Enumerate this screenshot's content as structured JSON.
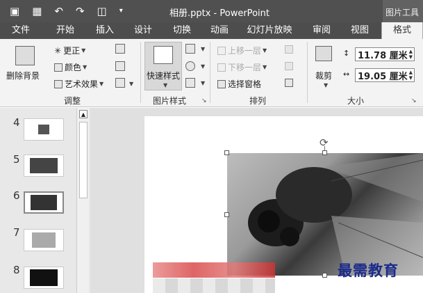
{
  "titlebar": {
    "title": "相册.pptx - PowerPoint",
    "context_tab": "图片工具"
  },
  "tabs": [
    "文件",
    "开始",
    "插入",
    "设计",
    "切换",
    "动画",
    "幻灯片放映",
    "审阅",
    "视图",
    "格式"
  ],
  "ribbon": {
    "remove_bg": "删除背景",
    "adjust": {
      "corrections": "更正",
      "color": "颜色",
      "artistic": "艺术效果",
      "label": "调整"
    },
    "picture_styles": {
      "quick_styles": "快速样式",
      "label": "图片样式"
    },
    "arrange": {
      "bring_forward": "上移一层",
      "send_backward": "下移一层",
      "selection_pane": "选择窗格",
      "label": "排列"
    },
    "size": {
      "crop": "裁剪",
      "height": "11.78 厘米",
      "width": "19.05 厘米",
      "label": "大小"
    }
  },
  "thumbnails": [
    {
      "num": "4",
      "selected": false
    },
    {
      "num": "5",
      "selected": false
    },
    {
      "num": "6",
      "selected": true
    },
    {
      "num": "7",
      "selected": false
    },
    {
      "num": "8",
      "selected": false
    }
  ],
  "watermark": "最需教育",
  "icons": {
    "save": "save-icon",
    "undo": "undo-icon",
    "redo": "redo-icon",
    "start_show": "start-show-icon",
    "customize": "customize-qat-icon",
    "app": "powerpoint-icon"
  }
}
